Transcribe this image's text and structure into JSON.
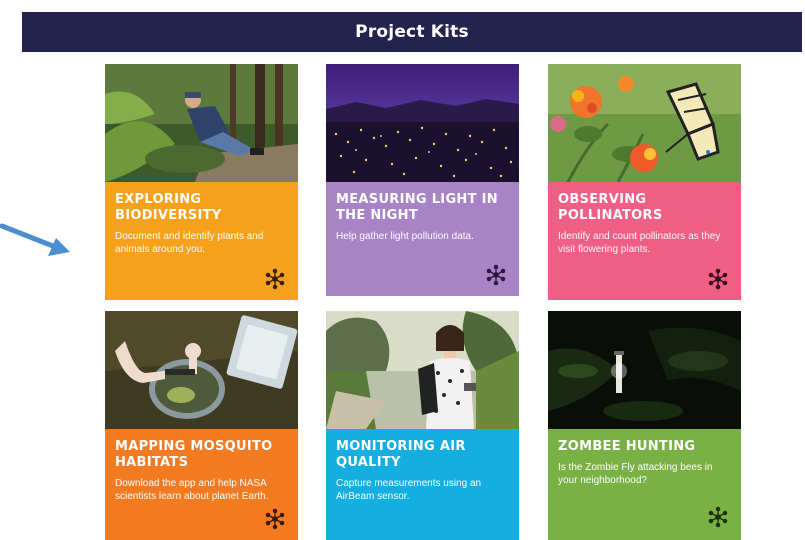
{
  "header": {
    "title": "Project Kits"
  },
  "kits": [
    {
      "title": "EXPLORING BIODIVERSITY",
      "description": "Document and identify plants and animals around you.",
      "color": "#f5a11c",
      "icon": "molecule-icon"
    },
    {
      "title": "MEASURING LIGHT IN THE NIGHT",
      "description": "Help gather light pollution data.",
      "color": "#a884c6",
      "icon": "molecule-icon"
    },
    {
      "title": "OBSERVING POLLINATORS",
      "description": "Identify and count pollinators as they visit flowering plants.",
      "color": "#ef5f85",
      "icon": "molecule-icon"
    },
    {
      "title": "MAPPING MOSQUITO HABITATS",
      "description": "Download the app and help NASA scientists learn about planet Earth.",
      "color": "#f27b22",
      "icon": "molecule-icon"
    },
    {
      "title": "MONITORING AIR QUALITY",
      "description": "Capture measurements using an AirBeam sensor.",
      "color": "#14aee0",
      "icon": "molecule-icon"
    },
    {
      "title": "ZOMBEE HUNTING",
      "description": "Is the Zombie Fly attacking bees in your neighborhood?",
      "color": "#7ab144",
      "icon": "molecule-icon"
    }
  ],
  "annotation": {
    "color": "#4a8fd0",
    "icon": "arrow-icon"
  }
}
